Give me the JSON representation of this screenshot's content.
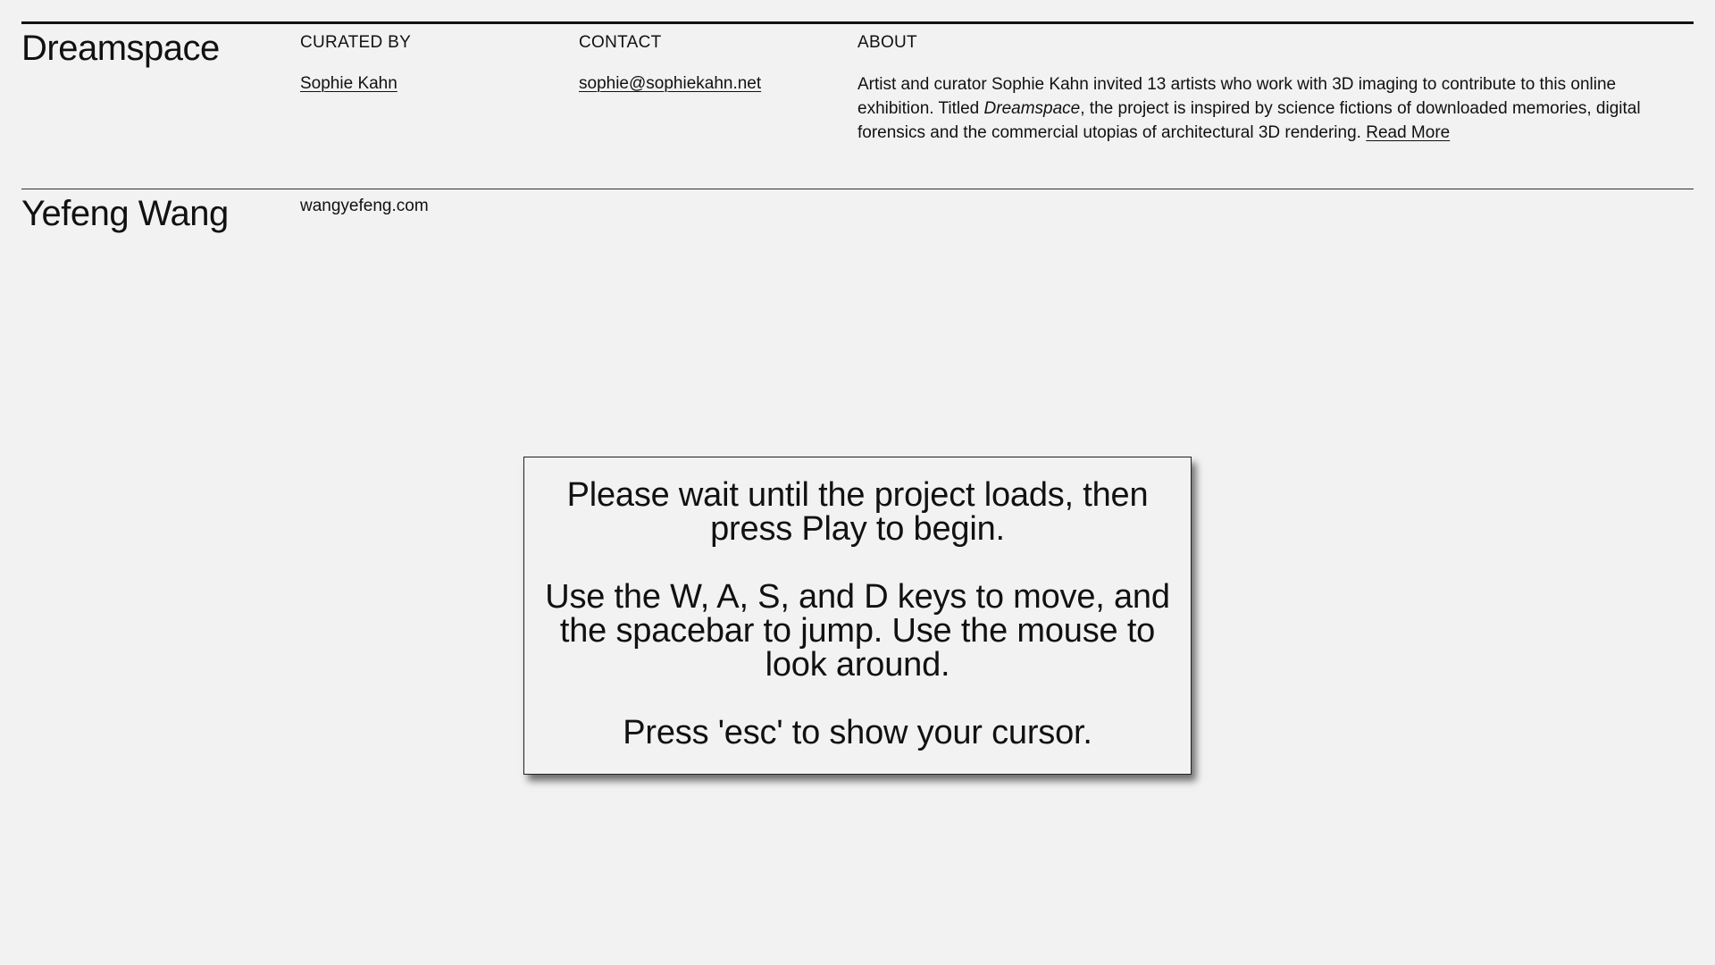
{
  "header": {
    "site_title": "Dreamspace",
    "curated_by_heading": "CURATED BY",
    "curator_name": "Sophie Kahn",
    "contact_heading": "CONTACT",
    "contact_email": "sophie@sophiekahn.net",
    "about_heading": "ABOUT",
    "about_text_part1": "Artist and curator Sophie Kahn invited 13 artists who work with 3D imaging to contribute to this online exhibition. Titled ",
    "about_text_italic": "Dreamspace",
    "about_text_part2": ", the project is inspired by science fictions of downloaded memories, digital forensics and the commercial utopias of architectural 3D rendering. ",
    "read_more_label": "Read More"
  },
  "artist": {
    "name": "Yefeng Wang",
    "website": "wangyefeng.com"
  },
  "instructions_modal": {
    "line_loading": "Please wait until the project loads, then press Play to begin.",
    "line_controls": "Use the W, A, S, and D keys to move, and the spacebar to jump. Use the mouse to look around.",
    "line_escape": "Press 'esc' to show your cursor."
  },
  "colors": {
    "background": "#f2f2f2",
    "text": "#111111"
  }
}
